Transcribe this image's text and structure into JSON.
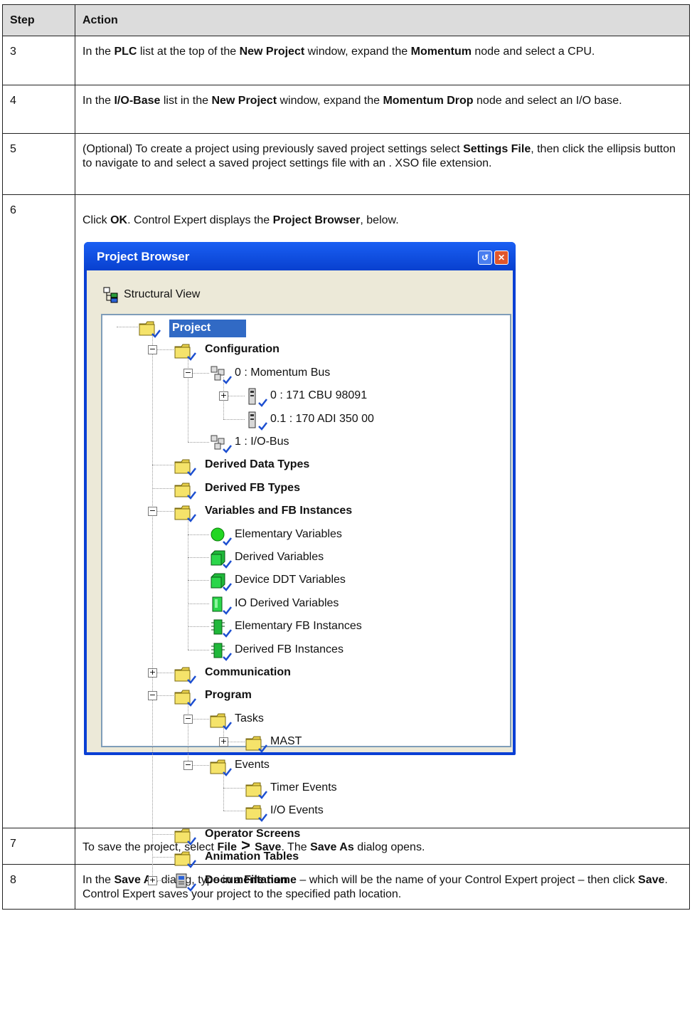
{
  "table": {
    "headers": {
      "step": "Step",
      "action": "Action"
    },
    "rows": [
      {
        "step": "3",
        "parts": [
          "In the ",
          "PLC",
          " list at the top of the ",
          "New Project",
          " window, expand the ",
          "Momentum",
          " node and select a CPU."
        ]
      },
      {
        "step": "4",
        "parts": [
          "In the ",
          "I/O-Base",
          " list in the ",
          "New Project",
          " window, expand the ",
          "Momentum Drop",
          " node and select an I/O base."
        ]
      },
      {
        "step": "5",
        "parts": [
          "(Optional) To create a project using previously saved project settings select ",
          "Settings File",
          ", then click the ellipsis button to navigate to and select a saved project settings file with an . XSO file extension."
        ]
      },
      {
        "step": "6",
        "parts": [
          "Click ",
          "OK",
          ". Control Expert displays the ",
          "Project Browser",
          ", below."
        ]
      },
      {
        "step": "7",
        "parts": [
          "To save the project, select ",
          "File",
          " > ",
          "Save",
          ". The ",
          "Save As",
          " dialog opens."
        ]
      },
      {
        "step": "8",
        "parts": [
          "In the ",
          "Save As",
          " dialog, type in a ",
          "File name",
          " – which will be the name of your Control Expert project – then click ",
          "Save",
          ". Control Expert saves your project to the specified path location."
        ]
      }
    ]
  },
  "browser": {
    "title": "Project Browser",
    "view_label": "Structural View",
    "nodes": [
      {
        "label": "Project",
        "icon": "folder-icon"
      },
      {
        "label": "Configuration",
        "icon": "folder-icon"
      },
      {
        "label": "0 : Momentum Bus",
        "icon": "bus-icon"
      },
      {
        "label": "0 : 171 CBU 98091",
        "icon": "module-icon"
      },
      {
        "label": "0.1 : 170 ADI 350 00",
        "icon": "module-icon"
      },
      {
        "label": "1 : I/O-Bus",
        "icon": "bus-icon"
      },
      {
        "label": "Derived Data Types",
        "icon": "folder-icon"
      },
      {
        "label": "Derived FB Types",
        "icon": "folder-icon"
      },
      {
        "label": "Variables and FB Instances",
        "icon": "folder-icon"
      },
      {
        "label": "Elementary Variables",
        "icon": "green-ball-icon"
      },
      {
        "label": "Derived Variables",
        "icon": "green-block-icon"
      },
      {
        "label": "Device DDT Variables",
        "icon": "green-block-icon"
      },
      {
        "label": "IO Derived Variables",
        "icon": "io-block-icon"
      },
      {
        "label": "Elementary FB Instances",
        "icon": "fb-icon"
      },
      {
        "label": "Derived FB Instances",
        "icon": "fb-icon"
      },
      {
        "label": "Communication",
        "icon": "folder-icon"
      },
      {
        "label": "Program",
        "icon": "folder-icon"
      },
      {
        "label": "Tasks",
        "icon": "folder-icon"
      },
      {
        "label": "MAST",
        "icon": "folder-icon"
      },
      {
        "label": "Events",
        "icon": "folder-icon"
      },
      {
        "label": "Timer Events",
        "icon": "folder-icon"
      },
      {
        "label": "I/O Events",
        "icon": "folder-icon"
      },
      {
        "label": "Operator Screens",
        "icon": "folder-icon"
      },
      {
        "label": "Animation Tables",
        "icon": "folder-icon"
      },
      {
        "label": "Documentation",
        "icon": "documentation-icon"
      }
    ]
  }
}
